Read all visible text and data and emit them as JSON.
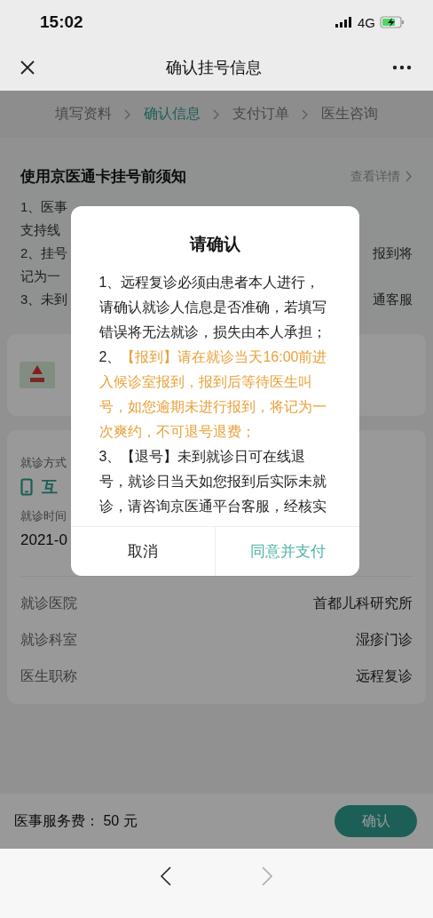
{
  "status_bar": {
    "time": "15:02",
    "network": "4G"
  },
  "nav_bar": {
    "title": "确认挂号信息"
  },
  "steps": [
    {
      "label": "填写资料",
      "selected": false
    },
    {
      "label": "确认信息",
      "selected": true
    },
    {
      "label": "支付订单",
      "selected": false
    },
    {
      "label": "医生咨询",
      "selected": false
    }
  ],
  "notice_card": {
    "title": "使用京医通卡挂号前须知",
    "link": "查看详情",
    "lines": [
      {
        "left": "1、医事"
      },
      {
        "left": "支持线"
      },
      {
        "left": "2、挂号",
        "right": "报到将"
      },
      {
        "left": "记为一"
      },
      {
        "left": "3、未到",
        "right": "通客服"
      }
    ]
  },
  "details": {
    "mode_label": "就诊方式",
    "mode_value": "互",
    "time_label": "就诊时间",
    "time_value": "2021-0",
    "rows": [
      {
        "label": "就诊医院",
        "value": "首都儿科研究所"
      },
      {
        "label": "就诊科室",
        "value": "湿疹门诊"
      },
      {
        "label": "医生职称",
        "value": "远程复诊"
      }
    ]
  },
  "footer": {
    "fee": "医事服务费： 50 元",
    "button": "确认"
  },
  "dialog": {
    "title": "请确认",
    "items": [
      {
        "number": "1、",
        "text": "远程复诊必须由患者本人进行，请确认就诊人信息是否准确，若填写错误将无法就诊，损失由本人承担；",
        "highlight": false
      },
      {
        "number": "2、",
        "text": "【报到】请在就诊当天16:00前进入候诊室报到，报到后等待医生叫号，如您逾期未进行报到，将记为一次爽约，不可退号退费；",
        "highlight": true
      },
      {
        "number": "3、",
        "text": "【退号】未到就诊日可在线退号，就诊日当天如您报到后实际未就诊，请咨询京医通平台客服，经核实",
        "highlight": false
      }
    ],
    "cancel": "取消",
    "confirm": "同意并支付"
  },
  "browser_nav": [
    {
      "kind": "back",
      "disabled": false
    },
    {
      "kind": "forward",
      "disabled": true
    }
  ]
}
